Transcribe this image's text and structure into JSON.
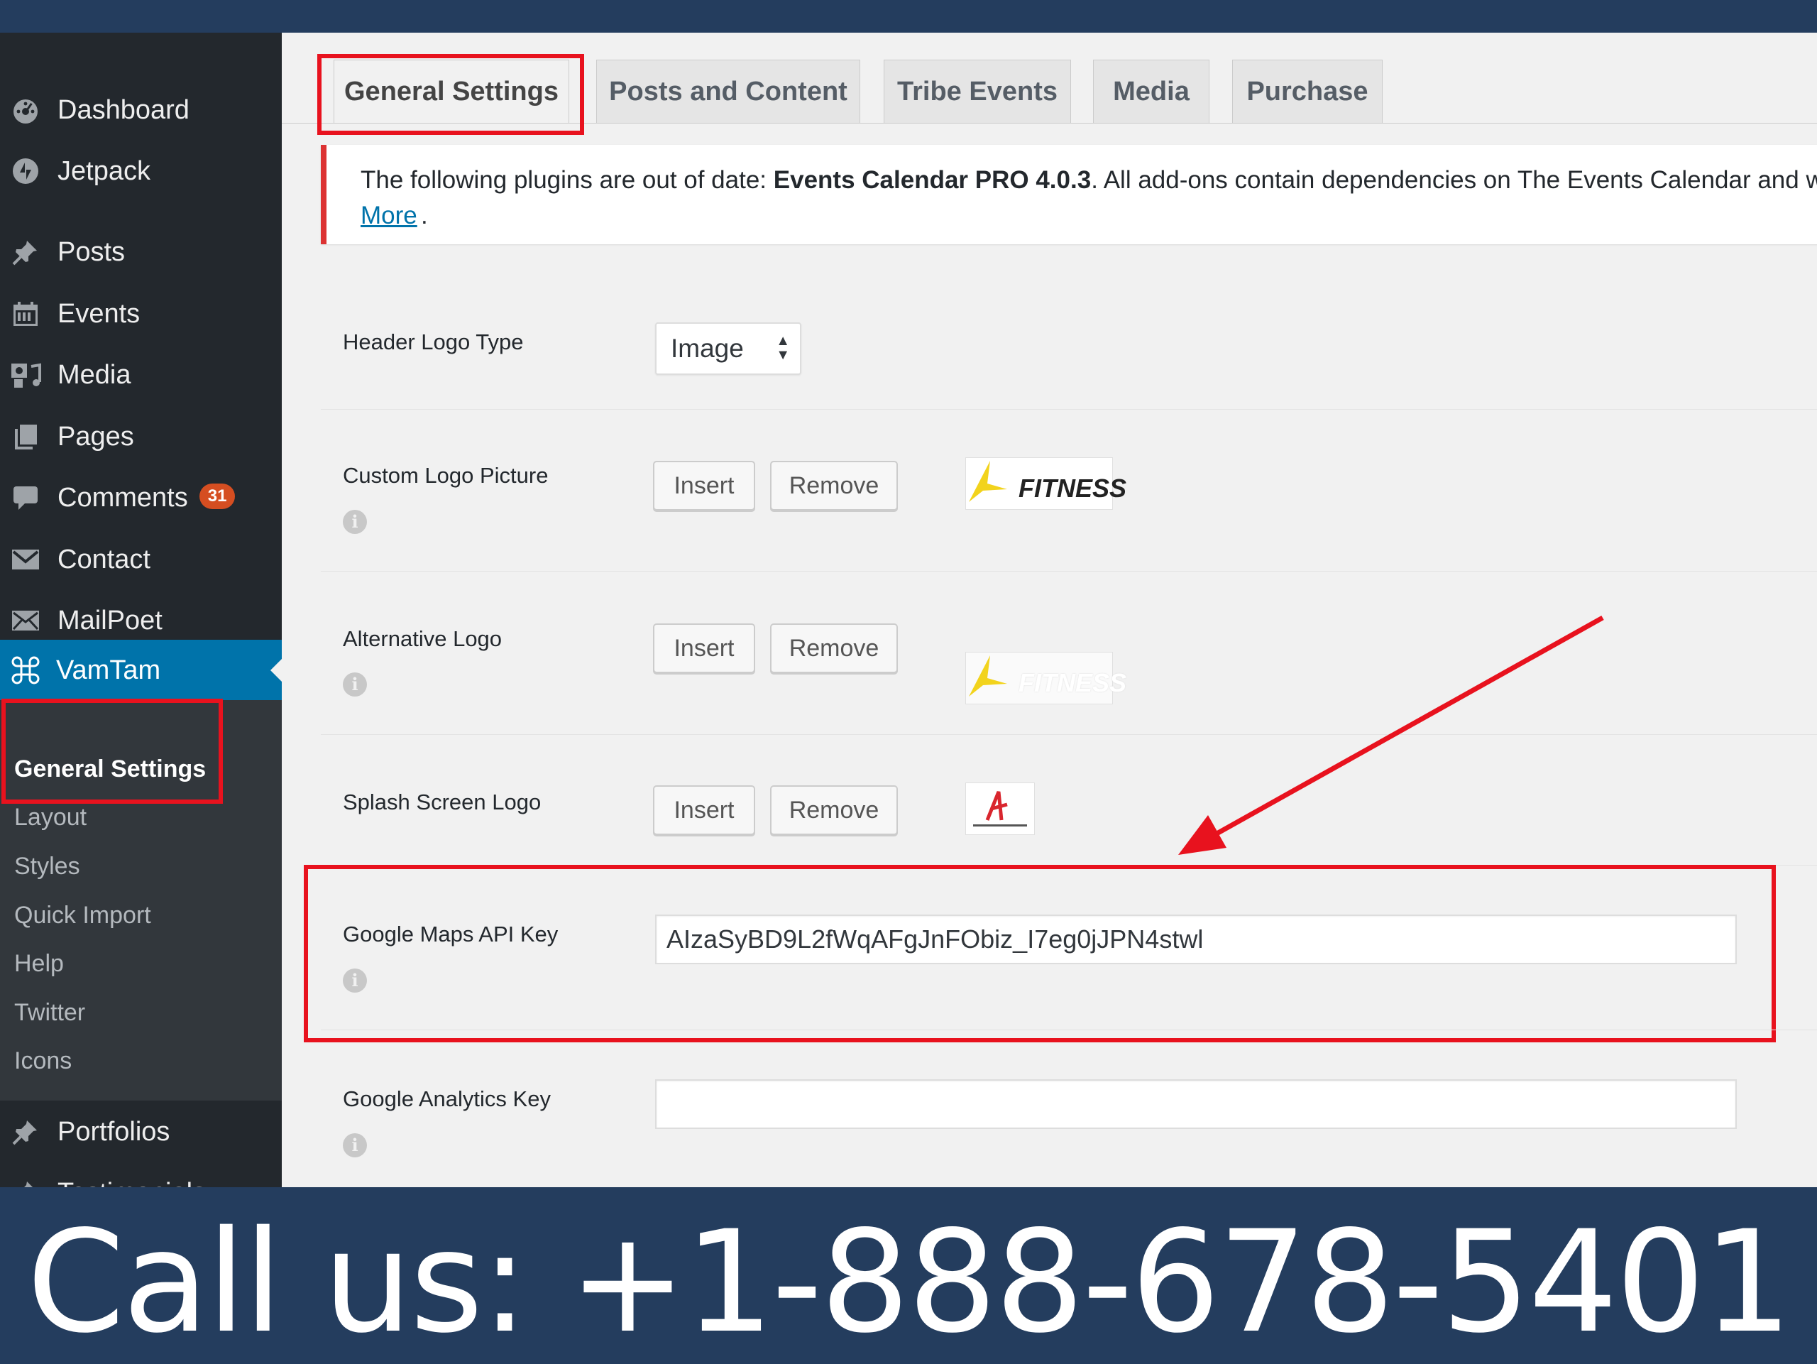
{
  "sidebar": {
    "items": [
      {
        "label": "Dashboard",
        "icon": "dashboard-icon"
      },
      {
        "label": "Jetpack",
        "icon": "jetpack-icon"
      },
      {
        "label": "Posts",
        "icon": "pin-icon"
      },
      {
        "label": "Events",
        "icon": "calendar-icon"
      },
      {
        "label": "Media",
        "icon": "media-icon"
      },
      {
        "label": "Pages",
        "icon": "pages-icon"
      },
      {
        "label": "Comments",
        "icon": "comment-icon",
        "badge": "31"
      },
      {
        "label": "Contact",
        "icon": "mail-icon"
      },
      {
        "label": "MailPoet",
        "icon": "mail-icon"
      },
      {
        "label": "VamTam",
        "icon": "command-icon"
      },
      {
        "label": "Portfolios",
        "icon": "pin-icon"
      },
      {
        "label": "Testimonials",
        "icon": "pin-icon"
      }
    ],
    "submenu": [
      "General Settings",
      "Layout",
      "Styles",
      "Quick Import",
      "Help",
      "Twitter",
      "Icons"
    ]
  },
  "tabs": [
    "General Settings",
    "Posts and Content",
    "Tribe Events",
    "Media",
    "Purchase"
  ],
  "notice": {
    "prefix": "The following plugins are out of date: ",
    "plugin": "Events Calendar PRO 4.0.3",
    "suffix": ". All add-ons contain dependencies on The Events Calendar and will n",
    "link": "More",
    "link_suffix": "."
  },
  "settings": {
    "header_logo_type": {
      "label": "Header Logo Type",
      "value": "Image"
    },
    "custom_logo": {
      "label": "Custom Logo Picture",
      "logo_text": "FITNESS"
    },
    "alternative_logo": {
      "label": "Alternative Logo",
      "logo_text": "FITNESS"
    },
    "splash_logo": {
      "label": "Splash Screen Logo"
    },
    "google_maps": {
      "label": "Google Maps API Key",
      "value": "AIzaSyBD9L2fWqAFgJnFObiz_I7eg0jJPN4stwl"
    },
    "google_analytics": {
      "label": "Google Analytics Key",
      "value": ""
    },
    "insert_label": "Insert",
    "remove_label": "Remove",
    "info_glyph": "i"
  },
  "banner": {
    "text": "Call us: +1-888-678-5401"
  },
  "colors": {
    "highlight": "#e8121e",
    "accent": "#0073aa",
    "sidebar": "#23282d",
    "banner": "#243d5e"
  }
}
